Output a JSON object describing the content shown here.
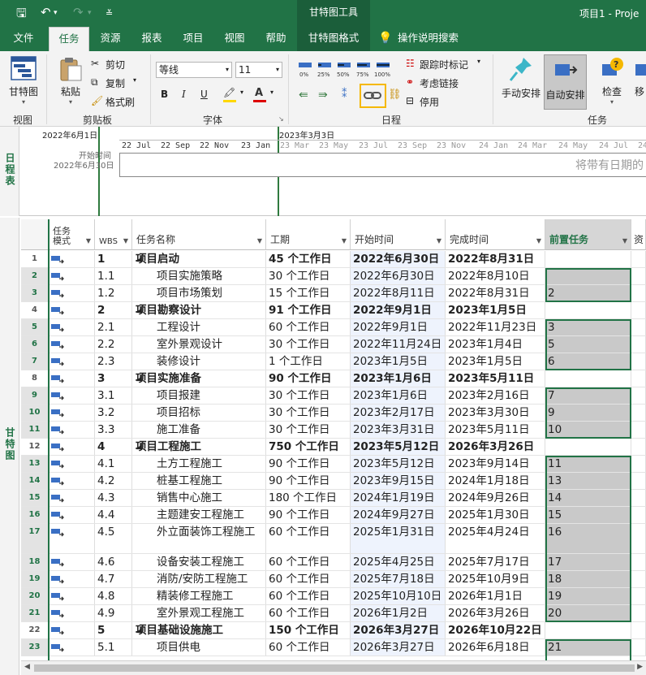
{
  "titlebar": {
    "context_label": "甘特图工具",
    "document_title": "项目1 - Proje"
  },
  "tabs": [
    {
      "label": "文件"
    },
    {
      "label": "任务"
    },
    {
      "label": "资源"
    },
    {
      "label": "报表"
    },
    {
      "label": "项目"
    },
    {
      "label": "视图"
    },
    {
      "label": "帮助"
    },
    {
      "label": "甘特图格式"
    },
    {
      "label": "操作说明搜索"
    }
  ],
  "ribbon": {
    "view": {
      "gantt_label": "甘特图",
      "group_label": "视图"
    },
    "clipboard": {
      "paste_label": "粘贴",
      "cut_label": "剪切",
      "copy_label": "复制",
      "format_painter_label": "格式刷",
      "group_label": "剪贴板"
    },
    "font": {
      "font_name": "等线",
      "font_size": "11",
      "bold": "B",
      "italic": "I",
      "underline": "U",
      "group_label": "字体"
    },
    "schedule": {
      "percents": [
        "0%",
        "25%",
        "50%",
        "75%",
        "100%"
      ],
      "track_label": "跟踪时标记",
      "respect_links_label": "考虑链接",
      "inactivate_label": "停用",
      "group_label": "日程"
    },
    "tasks": {
      "manual_label": "手动安排",
      "auto_label": "自动安排",
      "inspect_label": "检查",
      "move_label": "移",
      "group_label": "任务"
    }
  },
  "timeline": {
    "label": "日程表",
    "start_date": "2022年6月1日",
    "today_date": "2023年3月3日",
    "start_caption": "开始时间",
    "start_caption_date": "2022年6月30日",
    "ticks": [
      "22 Jul",
      "22 Sep",
      "22 Nov",
      "23 Jan",
      "23 Mar",
      "23 May",
      "23 Jul",
      "23 Sep",
      "23 Nov",
      "24 Jan",
      "24 Mar",
      "24 May",
      "24 Jul",
      "24"
    ],
    "placeholder": "将带有日期的"
  },
  "gantt_label": "甘特图",
  "columns": {
    "mode": "任务\n模式",
    "wbs": "WBS",
    "name": "任务名称",
    "duration": "工期",
    "start": "开始时间",
    "finish": "完成时间",
    "predecessors": "前置任务",
    "resources": "资"
  },
  "rows": [
    {
      "id": "1",
      "wbs": "1",
      "name": "项目启动",
      "duration": "45 个工作日",
      "start": "2022年6月30日",
      "finish": "2022年8月31日",
      "pred": ""
    },
    {
      "id": "2",
      "wbs": "1.1",
      "name": "项目实施策略",
      "duration": "30 个工作日",
      "start": "2022年6月30日",
      "finish": "2022年8月10日",
      "pred": ""
    },
    {
      "id": "3",
      "wbs": "1.2",
      "name": "项目市场策划",
      "duration": "15 个工作日",
      "start": "2022年8月11日",
      "finish": "2022年8月31日",
      "pred": "2"
    },
    {
      "id": "4",
      "wbs": "2",
      "name": "项目勘察设计",
      "duration": "91 个工作日",
      "start": "2022年9月1日",
      "finish": "2023年1月5日",
      "pred": ""
    },
    {
      "id": "5",
      "wbs": "2.1",
      "name": "工程设计",
      "duration": "60 个工作日",
      "start": "2022年9月1日",
      "finish": "2022年11月23日",
      "pred": "3"
    },
    {
      "id": "6",
      "wbs": "2.2",
      "name": "室外景观设计",
      "duration": "30 个工作日",
      "start": "2022年11月24日",
      "finish": "2023年1月4日",
      "pred": "5"
    },
    {
      "id": "7",
      "wbs": "2.3",
      "name": "装修设计",
      "duration": "1 个工作日",
      "start": "2023年1月5日",
      "finish": "2023年1月5日",
      "pred": "6"
    },
    {
      "id": "8",
      "wbs": "3",
      "name": "项目实施准备",
      "duration": "90 个工作日",
      "start": "2023年1月6日",
      "finish": "2023年5月11日",
      "pred": ""
    },
    {
      "id": "9",
      "wbs": "3.1",
      "name": "项目报建",
      "duration": "30 个工作日",
      "start": "2023年1月6日",
      "finish": "2023年2月16日",
      "pred": "7"
    },
    {
      "id": "10",
      "wbs": "3.2",
      "name": "项目招标",
      "duration": "30 个工作日",
      "start": "2023年2月17日",
      "finish": "2023年3月30日",
      "pred": "9"
    },
    {
      "id": "11",
      "wbs": "3.3",
      "name": "施工准备",
      "duration": "30 个工作日",
      "start": "2023年3月31日",
      "finish": "2023年5月11日",
      "pred": "10"
    },
    {
      "id": "12",
      "wbs": "4",
      "name": "项目工程施工",
      "duration": "750 个工作日",
      "start": "2023年5月12日",
      "finish": "2026年3月26日",
      "pred": ""
    },
    {
      "id": "13",
      "wbs": "4.1",
      "name": "土方工程施工",
      "duration": "90 个工作日",
      "start": "2023年5月12日",
      "finish": "2023年9月14日",
      "pred": "11"
    },
    {
      "id": "14",
      "wbs": "4.2",
      "name": "桩基工程施工",
      "duration": "90 个工作日",
      "start": "2023年9月15日",
      "finish": "2024年1月18日",
      "pred": "13"
    },
    {
      "id": "15",
      "wbs": "4.3",
      "name": "销售中心施工",
      "duration": "180 个工作日",
      "start": "2024年1月19日",
      "finish": "2024年9月26日",
      "pred": "14"
    },
    {
      "id": "16",
      "wbs": "4.4",
      "name": "主题建安工程施工",
      "duration": "90 个工作日",
      "start": "2024年9月27日",
      "finish": "2025年1月30日",
      "pred": "15"
    },
    {
      "id": "17",
      "wbs": "4.5",
      "name": "外立面装饰工程施工",
      "duration": "60 个工作日",
      "start": "2025年1月31日",
      "finish": "2025年4月24日",
      "pred": "16"
    },
    {
      "id": "18",
      "wbs": "4.6",
      "name": "设备安装工程施工",
      "duration": "60 个工作日",
      "start": "2025年4月25日",
      "finish": "2025年7月17日",
      "pred": "17"
    },
    {
      "id": "19",
      "wbs": "4.7",
      "name": "消防/安防工程施工",
      "duration": "60 个工作日",
      "start": "2025年7月18日",
      "finish": "2025年10月9日",
      "pred": "18"
    },
    {
      "id": "20",
      "wbs": "4.8",
      "name": "精装修工程施工",
      "duration": "60 个工作日",
      "start": "2025年10月10日",
      "finish": "2026年1月1日",
      "pred": "19"
    },
    {
      "id": "21",
      "wbs": "4.9",
      "name": "室外景观工程施工",
      "duration": "60 个工作日",
      "start": "2026年1月2日",
      "finish": "2026年3月26日",
      "pred": "20"
    },
    {
      "id": "22",
      "wbs": "5",
      "name": "项目基础设施施工",
      "duration": "150 个工作日",
      "start": "2026年3月27日",
      "finish": "2026年10月22日",
      "pred": ""
    },
    {
      "id": "23",
      "wbs": "5.1",
      "name": "项目供电",
      "duration": "60 个工作日",
      "start": "2026年3月27日",
      "finish": "2026年6月18日",
      "pred": "21"
    }
  ],
  "colors": {
    "brand": "#217346",
    "highlight": "#f5b800",
    "pin": "#3cb6c8"
  }
}
